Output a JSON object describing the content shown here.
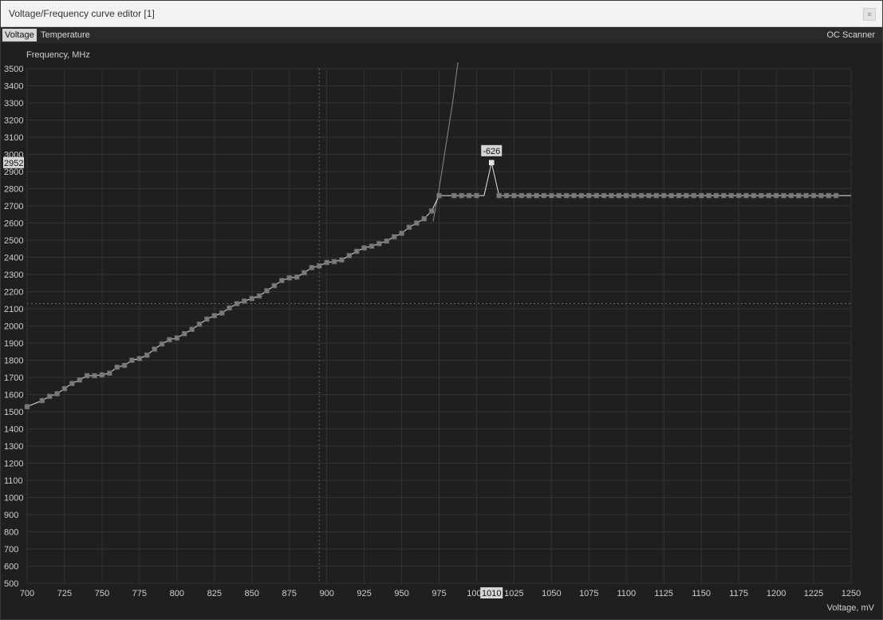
{
  "window": {
    "title": "Voltage/Frequency curve editor [1]",
    "menu_glyph": "≡"
  },
  "tabs": {
    "voltage": "Voltage",
    "temperature": "Temperature",
    "oc_scanner": "OC Scanner"
  },
  "colors": {
    "background": "#1f1f21",
    "grid": "#333336",
    "curve": "#e6e6e6",
    "point": "#7a7a7a"
  },
  "chart_data": {
    "type": "line",
    "ylabel": "Frequency, MHz",
    "xlabel": "Voltage, mV",
    "xlim": [
      700,
      1250
    ],
    "ylim": [
      500,
      3500
    ],
    "grid": true,
    "x_ticks": [
      700,
      725,
      750,
      775,
      800,
      825,
      850,
      875,
      900,
      925,
      950,
      975,
      1000,
      1025,
      1050,
      1075,
      1100,
      1125,
      1150,
      1175,
      1200,
      1225,
      1250
    ],
    "y_ticks": [
      500,
      600,
      700,
      800,
      900,
      1000,
      1100,
      1200,
      1300,
      1400,
      1500,
      1600,
      1700,
      1800,
      1900,
      2000,
      2100,
      2200,
      2300,
      2400,
      2500,
      2600,
      2700,
      2800,
      2900,
      3000,
      3100,
      3200,
      3300,
      3400,
      3500
    ],
    "series": [
      {
        "x": [
          700,
          710,
          715,
          720,
          725,
          730,
          735,
          740,
          745,
          750,
          755,
          760,
          765,
          770,
          775,
          780,
          785,
          790,
          795,
          800,
          805,
          810,
          815,
          820,
          825,
          830,
          835,
          840,
          845,
          850,
          855,
          860,
          865,
          870,
          875,
          880,
          885,
          890,
          895,
          900,
          905,
          910,
          915,
          920,
          925,
          930,
          935,
          940,
          945,
          950,
          955,
          960,
          965,
          970,
          975,
          981,
          985,
          990,
          995,
          1000,
          1005,
          1010,
          1015,
          1020,
          1025,
          1030,
          1035,
          1040,
          1045,
          1050,
          1055,
          1060,
          1065,
          1070,
          1075,
          1080,
          1085,
          1090,
          1095,
          1100,
          1105,
          1110,
          1115,
          1120,
          1125,
          1130,
          1135,
          1140,
          1145,
          1150,
          1155,
          1160,
          1165,
          1170,
          1175,
          1180,
          1185,
          1190,
          1195,
          1200,
          1205,
          1210,
          1215,
          1220,
          1225,
          1230,
          1235,
          1240,
          1245,
          1250
        ],
        "y": [
          1530,
          1565,
          1590,
          1605,
          1635,
          1665,
          1685,
          1710,
          1710,
          1715,
          1725,
          1760,
          1770,
          1800,
          1810,
          1830,
          1865,
          1895,
          1920,
          1930,
          1955,
          1980,
          2010,
          2040,
          2060,
          2075,
          2105,
          2130,
          2145,
          2160,
          2175,
          2205,
          2235,
          2265,
          2280,
          2285,
          2310,
          2340,
          2350,
          2370,
          2375,
          2385,
          2410,
          2435,
          2455,
          2465,
          2480,
          2495,
          2520,
          2540,
          2575,
          2600,
          2625,
          2670,
          2760,
          2760,
          2760,
          2760,
          2760,
          2760,
          2760,
          2952,
          2760,
          2760,
          2760,
          2760,
          2760,
          2760,
          2760,
          2760,
          2760,
          2760,
          2760,
          2760,
          2760,
          2760,
          2760,
          2760,
          2760,
          2760,
          2760,
          2760,
          2760,
          2760,
          2760,
          2760,
          2760,
          2760,
          2760,
          2760,
          2760,
          2760,
          2760,
          2760,
          2760,
          2760,
          2760,
          2760,
          2760,
          2760,
          2760,
          2760,
          2760,
          2760,
          2760,
          2760,
          2760,
          2760,
          2760,
          2760
        ]
      }
    ],
    "marker_x": [
      700,
      710,
      715,
      720,
      725,
      730,
      735,
      740,
      745,
      750,
      755,
      760,
      765,
      770,
      775,
      780,
      785,
      790,
      795,
      800,
      805,
      810,
      815,
      820,
      825,
      830,
      835,
      840,
      845,
      850,
      855,
      860,
      865,
      870,
      875,
      880,
      885,
      890,
      895,
      900,
      905,
      910,
      915,
      920,
      925,
      930,
      935,
      940,
      945,
      950,
      955,
      960,
      965,
      970,
      975,
      985,
      990,
      995,
      1000,
      1010,
      1015,
      1020,
      1025,
      1030,
      1035,
      1040,
      1045,
      1050,
      1055,
      1060,
      1065,
      1070,
      1075,
      1080,
      1085,
      1090,
      1095,
      1100,
      1105,
      1110,
      1115,
      1120,
      1125,
      1130,
      1135,
      1140,
      1145,
      1150,
      1155,
      1160,
      1165,
      1170,
      1175,
      1180,
      1185,
      1190,
      1195,
      1200,
      1205,
      1210,
      1215,
      1220,
      1225,
      1230,
      1235,
      1240
    ],
    "trace": {
      "x": [
        971,
        975,
        984,
        990
      ],
      "y": [
        2610,
        2800,
        3300,
        3700
      ]
    },
    "crosshair": {
      "x": 895,
      "y": 2130
    },
    "selected_point": {
      "x": 1010,
      "y": 2952,
      "x_label": "1010",
      "y_label": "2952",
      "annotation": "-626"
    }
  }
}
